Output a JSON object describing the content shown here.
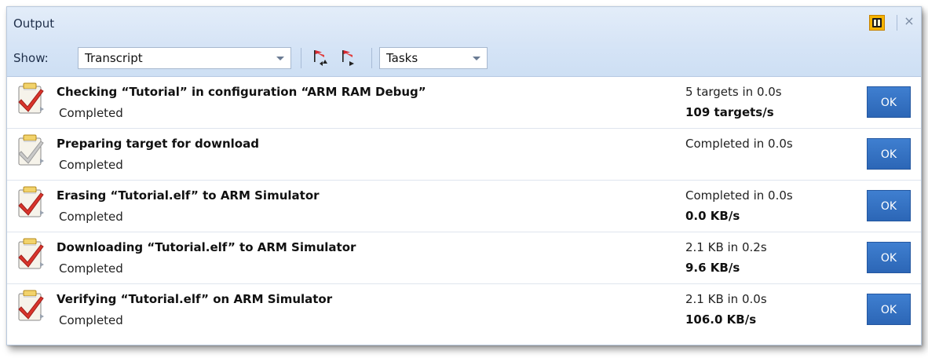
{
  "panel": {
    "title": "Output",
    "close_glyph": "×"
  },
  "toolbar": {
    "show_label": "Show:",
    "view_select": "Transcript",
    "filter_select": "Tasks"
  },
  "colors": {
    "header_bg": "#d6e4f6",
    "ok_button": "#2f6cbc",
    "icon_check": "#d9342b",
    "icon_clipboard": "#f2d36b"
  },
  "icons": {
    "task": "clipboard-check-icon",
    "prev_error": "flag-prev-icon",
    "next_error": "flag-next-icon",
    "docs": "book-icon",
    "close": "close-icon"
  },
  "tasks": [
    {
      "title": "Checking “Tutorial” in configuration “ARM RAM Debug”",
      "status": "Completed",
      "stat_line1": "5 targets in 0.0s",
      "stat_line2": "109 targets/s",
      "button": "OK"
    },
    {
      "title": "Preparing target for download",
      "status": "Completed",
      "stat_line1": "Completed in 0.0s",
      "stat_line2": "",
      "button": "OK"
    },
    {
      "title": "Erasing “Tutorial.elf” to ARM Simulator",
      "status": "Completed",
      "stat_line1": "Completed in 0.0s",
      "stat_line2": "0.0 KB/s",
      "button": "OK"
    },
    {
      "title": "Downloading “Tutorial.elf” to ARM Simulator",
      "status": "Completed",
      "stat_line1": "2.1 KB in 0.2s",
      "stat_line2": "9.6 KB/s",
      "button": "OK"
    },
    {
      "title": "Verifying “Tutorial.elf” on ARM Simulator",
      "status": "Completed",
      "stat_line1": "2.1 KB in 0.0s",
      "stat_line2": "106.0 KB/s",
      "button": "OK"
    }
  ]
}
